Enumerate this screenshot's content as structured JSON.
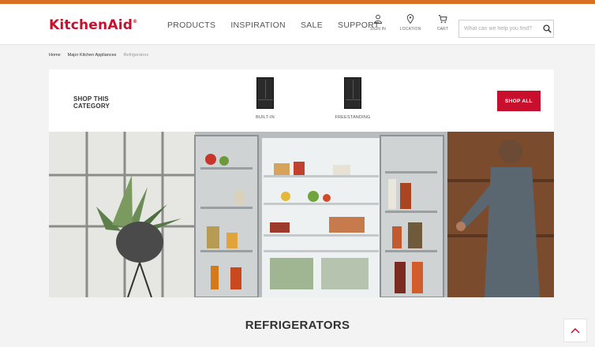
{
  "brand": {
    "logo": "KitchenAid",
    "mark": "®"
  },
  "nav": {
    "items": [
      "PRODUCTS",
      "INSPIRATION",
      "SALE",
      "SUPPORT"
    ]
  },
  "utility": {
    "sign_in": "SIGN IN",
    "location": "LOCATION",
    "cart": "CART"
  },
  "search": {
    "placeholder": "What can we help you find?",
    "value": ""
  },
  "breadcrumb": [
    "Home",
    "Major Kitchen Appliances",
    "Refrigerators"
  ],
  "category": {
    "title_line1": "SHOP THIS",
    "title_line2": "CATEGORY",
    "items": [
      "BUILT-IN",
      "FREESTANDING"
    ],
    "shop_all": "SHOP ALL"
  },
  "page_title": "REFRIGERATORS",
  "colors": {
    "brand_red": "#c8102e",
    "top_accent": "#d96f22",
    "background": "#f3f3f3"
  },
  "icons": {
    "sign_in": "person-icon",
    "location": "map-pin-icon",
    "cart": "cart-icon",
    "search": "search-icon",
    "back_to_top": "chevron-up-icon"
  }
}
